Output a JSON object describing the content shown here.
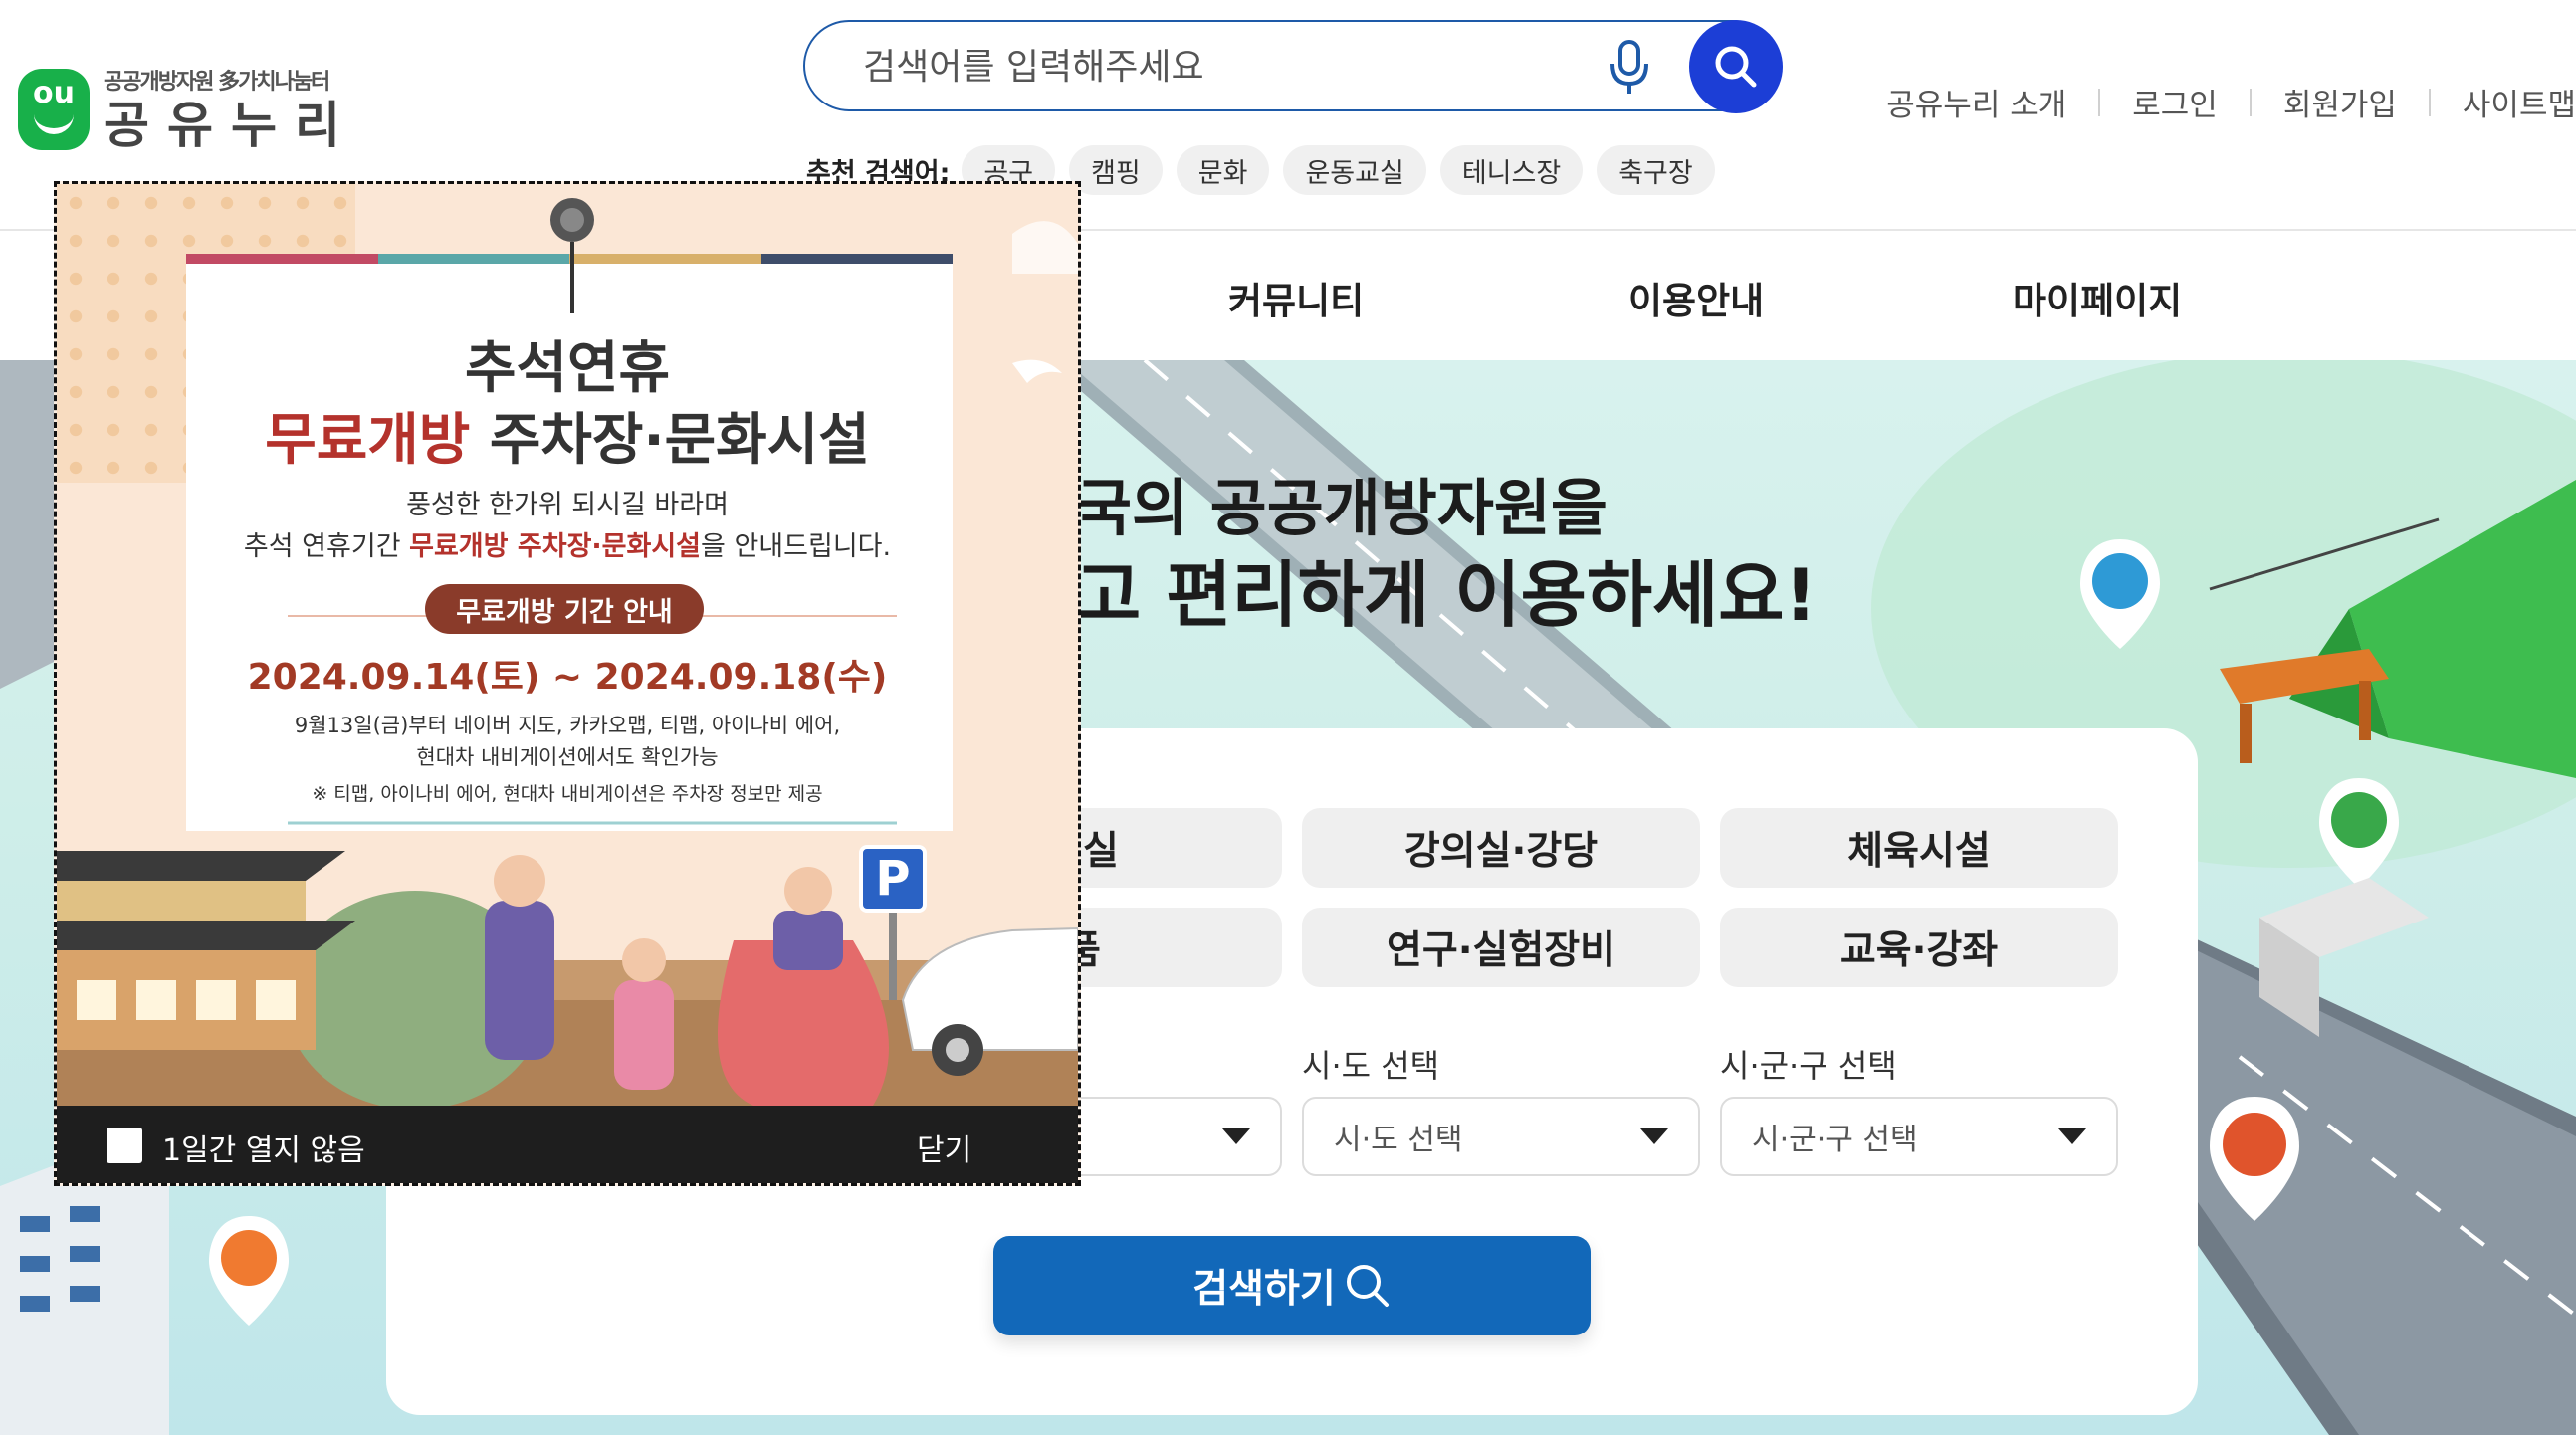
{
  "header": {
    "logo_sub": "공공개방자원 多가치나눔터",
    "logo_main": "공유누리",
    "logo_mark": "ou",
    "search_placeholder": "검색어를 입력해주세요",
    "recommend_label": "추천 검색어:",
    "recommend_chips": [
      "공구",
      "캠핑",
      "문화",
      "운동교실",
      "테니스장",
      "축구장"
    ],
    "util_links": [
      "공유누리 소개",
      "로그인",
      "회원가입",
      "사이트맵"
    ]
  },
  "nav": {
    "items": [
      "커뮤니티",
      "이용안내",
      "마이페이지"
    ]
  },
  "hero": {
    "title_line1": "국의 공공개방자원을",
    "title_line2": "고 편리하게 이용하세요!"
  },
  "search_card": {
    "categories": [
      "의실",
      "강의실·강당",
      "체육시설",
      "품",
      "연구·실험장비",
      "교육·강좌"
    ],
    "sido_label": "시·도 선택",
    "sido_value": "시·도 선택",
    "sigungu_label": "시·군·구 선택",
    "sigungu_value": "시·군·구 선택",
    "submit_label": "검색하기"
  },
  "popup": {
    "title1": "추석연휴",
    "title2_red": "무료개방",
    "title2_rest": " 주차장·문화시설",
    "line1": "풍성한 한가위 되시길 바라며",
    "line2_a": "추석 연휴기간 ",
    "line2_red": "무료개방 주차장·문화시설",
    "line2_b": "을 안내드립니다.",
    "pill": "무료개방 기간 안내",
    "date": "2024.09.14(토) ~ 2024.09.18(수)",
    "small1": "9월13일(금)부터  네이버 지도, 카카오맵, 티맵, 아이나비 에어,",
    "small2": "현대차 내비게이션에서도 확인가능",
    "small3": "※ 티맵, 아이나비 에어, 현대차 내비게이션은 주차장 정보만 제공",
    "parking_sign": "P",
    "dont_open_label": "1일간 열지 않음",
    "close_label": "닫기"
  },
  "colors": {
    "brand_green": "#18b04a",
    "search_blue": "#1c3ed6",
    "submit_blue": "#1268b9",
    "popup_red": "#b4322c"
  }
}
